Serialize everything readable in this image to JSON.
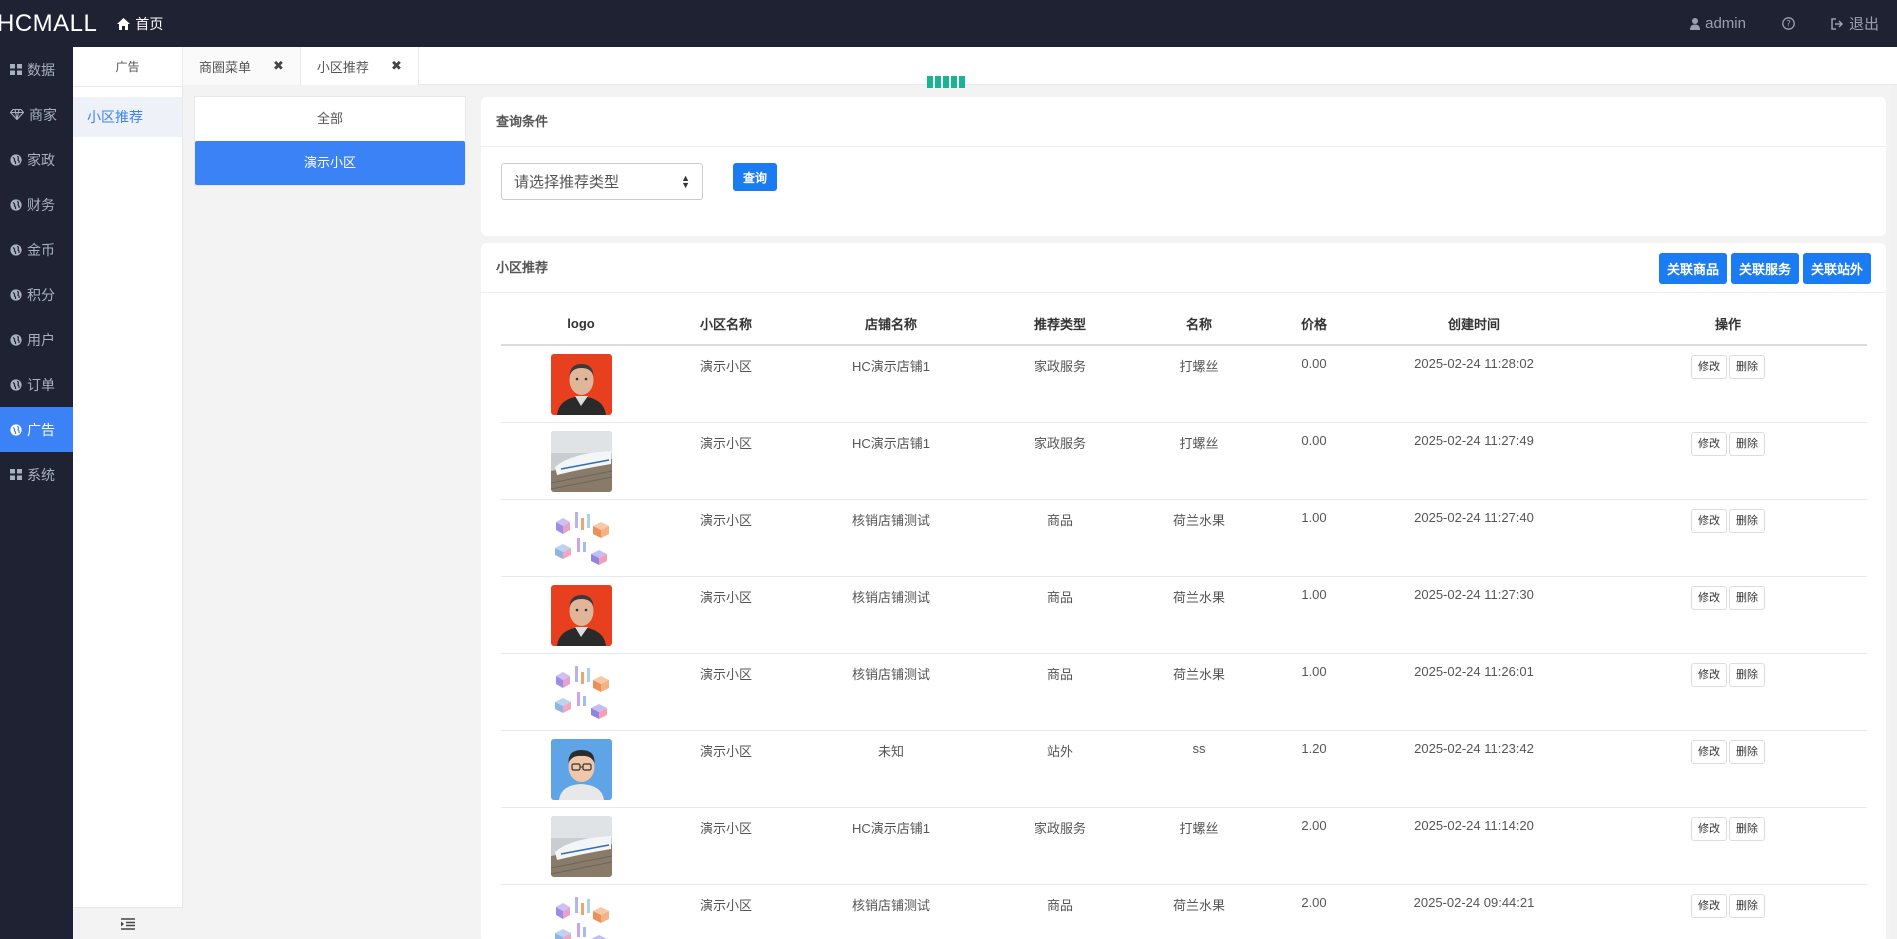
{
  "header": {
    "brand": "HCMALL",
    "home_label": "首页",
    "user_label": "admin",
    "logout_label": "退出"
  },
  "leftnav": {
    "items": [
      {
        "label": "数据",
        "icon": "grid-icon"
      },
      {
        "label": "商家",
        "icon": "diamond-icon"
      },
      {
        "label": "家政",
        "icon": "globe-icon"
      },
      {
        "label": "财务",
        "icon": "globe-icon"
      },
      {
        "label": "金币",
        "icon": "globe-icon"
      },
      {
        "label": "积分",
        "icon": "globe-icon"
      },
      {
        "label": "用户",
        "icon": "globe-icon"
      },
      {
        "label": "订单",
        "icon": "globe-icon"
      },
      {
        "label": "广告",
        "icon": "globe-icon",
        "active": true
      },
      {
        "label": "系统",
        "icon": "grid-icon"
      }
    ]
  },
  "subnav": {
    "title": "广告",
    "items": [
      {
        "label": "小区推荐"
      }
    ]
  },
  "tabs": [
    {
      "label": "商圈菜单"
    },
    {
      "label": "小区推荐",
      "active": true
    }
  ],
  "communities": {
    "items": [
      {
        "label": "全部"
      },
      {
        "label": "演示小区",
        "active": true
      }
    ]
  },
  "query": {
    "title": "查询条件",
    "select_value": "请选择推荐类型",
    "search_label": "查询"
  },
  "table": {
    "title": "小区推荐",
    "actions": [
      "关联商品",
      "关联服务",
      "关联站外"
    ],
    "columns": [
      "logo",
      "小区名称",
      "店铺名称",
      "推荐类型",
      "名称",
      "价格",
      "创建时间",
      "操作"
    ],
    "edit_label": "修改",
    "delete_label": "删除",
    "rows": [
      {
        "logo": "man-photo",
        "community": "演示小区",
        "shop": "HC演示店铺1",
        "type": "家政服务",
        "name": "打螺丝",
        "price": "0.00",
        "created": "2025-02-24 11:28:02"
      },
      {
        "logo": "train-photo",
        "community": "演示小区",
        "shop": "HC演示店铺1",
        "type": "家政服务",
        "name": "打螺丝",
        "price": "0.00",
        "created": "2025-02-24 11:27:49"
      },
      {
        "logo": "isometric-graphic",
        "community": "演示小区",
        "shop": "核销店铺测试",
        "type": "商品",
        "name": "荷兰水果",
        "price": "1.00",
        "created": "2025-02-24 11:27:40"
      },
      {
        "logo": "man-photo",
        "community": "演示小区",
        "shop": "核销店铺测试",
        "type": "商品",
        "name": "荷兰水果",
        "price": "1.00",
        "created": "2025-02-24 11:27:30"
      },
      {
        "logo": "isometric-graphic",
        "community": "演示小区",
        "shop": "核销店铺测试",
        "type": "商品",
        "name": "荷兰水果",
        "price": "1.00",
        "created": "2025-02-24 11:26:01"
      },
      {
        "logo": "boy-photo",
        "community": "演示小区",
        "shop": "未知",
        "type": "站外",
        "name": "ss",
        "price": "1.20",
        "created": "2025-02-24 11:23:42"
      },
      {
        "logo": "train-photo",
        "community": "演示小区",
        "shop": "HC演示店铺1",
        "type": "家政服务",
        "name": "打螺丝",
        "price": "2.00",
        "created": "2025-02-24 11:14:20"
      },
      {
        "logo": "isometric-graphic",
        "community": "演示小区",
        "shop": "核销店铺测试",
        "type": "商品",
        "name": "荷兰水果",
        "price": "2.00",
        "created": "2025-02-24 09:44:21"
      }
    ]
  },
  "colors": {
    "nav_bg": "#1e2233",
    "accent": "#3b82f6",
    "button": "#1a7bf2",
    "loader": "#1ab394"
  }
}
